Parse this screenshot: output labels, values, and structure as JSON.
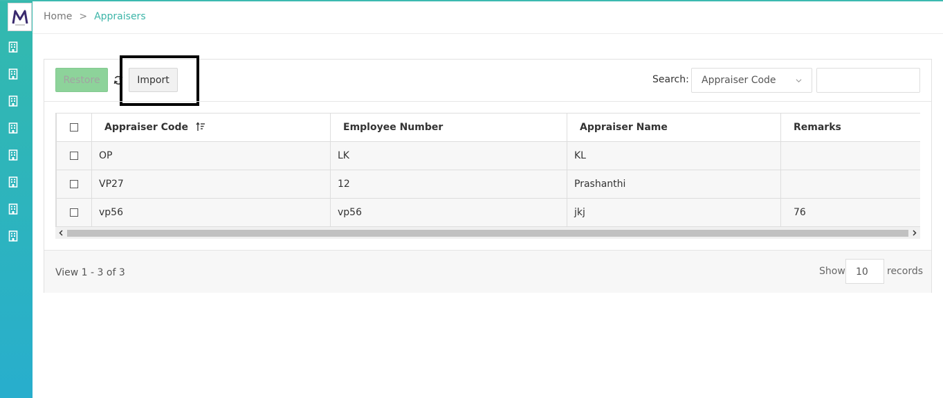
{
  "colors": {
    "accent": "#3cb5a8",
    "sidebar_top": "#33b9ad",
    "sidebar_bottom": "#28aecd",
    "restore_bg": "#8dd39a"
  },
  "logo": {
    "text": "M",
    "icon": "app-logo"
  },
  "sidebar": {
    "items": [
      {
        "icon": "building-icon"
      },
      {
        "icon": "building-icon"
      },
      {
        "icon": "building-icon"
      },
      {
        "icon": "building-icon"
      },
      {
        "icon": "building-icon"
      },
      {
        "icon": "building-icon"
      },
      {
        "icon": "building-icon"
      },
      {
        "icon": "building-icon"
      }
    ]
  },
  "breadcrumb": {
    "home": "Home",
    "separator": ">",
    "current": "Appraisers"
  },
  "toolbar": {
    "restore_label": "Restore",
    "import_label": "Import",
    "refresh_icon": "refresh-icon"
  },
  "search": {
    "label": "Search:",
    "selected_field": "Appraiser Code",
    "value": ""
  },
  "table": {
    "columns": [
      "Appraiser Code",
      "Employee Number",
      "Appraiser Name",
      "Remarks"
    ],
    "rows": [
      [
        "OP",
        "LK",
        "KL",
        ""
      ],
      [
        "VP27",
        "12",
        "Prashanthi",
        ""
      ],
      [
        "vp56",
        "vp56",
        "jkj",
        "76"
      ]
    ]
  },
  "footer": {
    "view_info": "View 1 - 3 of 3",
    "show_label": "Show",
    "page_size": "10",
    "records_label": "records"
  }
}
